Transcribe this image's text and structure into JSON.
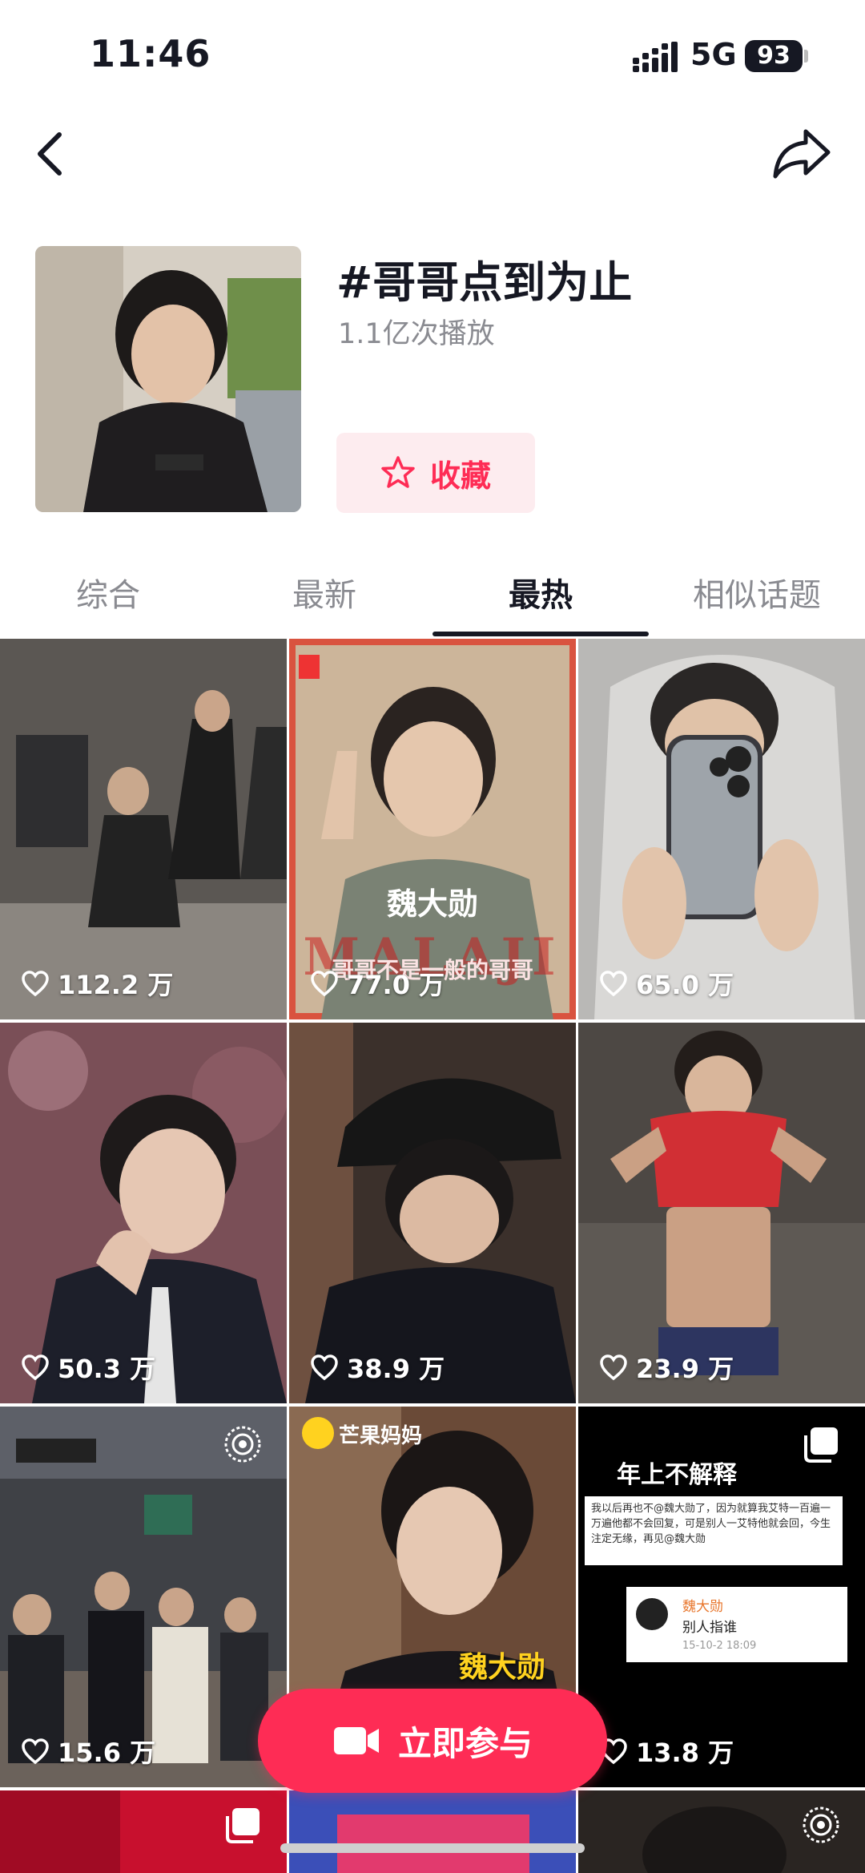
{
  "status_bar": {
    "time": "11:46",
    "network": "5G",
    "battery": "93"
  },
  "topic": {
    "title": "#哥哥点到为止",
    "plays": "1.1亿次播放",
    "favorite_label": "收藏"
  },
  "tabs": [
    {
      "label": "综合",
      "active": false
    },
    {
      "label": "最新",
      "active": false
    },
    {
      "label": "最热",
      "active": true
    },
    {
      "label": "相似话题",
      "active": false
    }
  ],
  "videos": [
    {
      "likes": "112.2 万"
    },
    {
      "likes": "77.0 万",
      "overlay_name": "魏大勋",
      "overlay_caption": "哥哥不是一般的哥哥",
      "overlay_big": "MALAJI"
    },
    {
      "likes": "65.0 万"
    },
    {
      "likes": "50.3 万"
    },
    {
      "likes": "38.9 万"
    },
    {
      "likes": "23.9 万"
    },
    {
      "likes": "15.6 万"
    },
    {
      "likes": "",
      "overlay_brand": "芒果妈妈",
      "overlay_name": "魏大勋"
    },
    {
      "likes": "13.8 万",
      "overlay_title": "年上不解释",
      "post_text": "我以后再也不@魏大勋了，因为就算我艾特一百遍一万遍他都不会回复，可是别人一艾特他就会回，今生注定无缘，再见@魏大勋",
      "reply_user": "魏大勋",
      "reply_text": "别人指谁",
      "reply_time": "15-10-2 18:09"
    }
  ],
  "cta_label": "立即参与",
  "colors": {
    "accent": "#fe2c55",
    "accent_bg": "#fdecef",
    "text": "#161823",
    "muted": "#8a8b91"
  }
}
